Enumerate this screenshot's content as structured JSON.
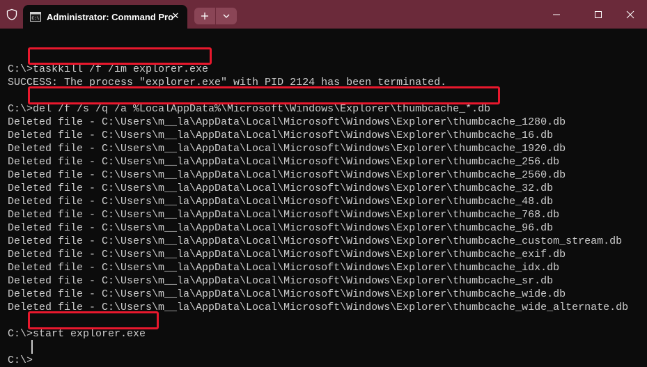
{
  "window": {
    "tab_title": "Administrator: Command Pro",
    "icons": [
      "shield-icon",
      "cmd-icon",
      "close-icon",
      "plus-icon",
      "chevron-down-icon",
      "minimize-icon",
      "maximize-icon",
      "window-close-icon"
    ]
  },
  "terminal": {
    "lines": [
      "",
      "C:\\>taskkill /f /im explorer.exe",
      "SUCCESS: The process \"explorer.exe\" with PID 2124 has been terminated.",
      "",
      "C:\\>del /f /s /q /a %LocalAppData%\\Microsoft\\Windows\\Explorer\\thumbcache_*.db",
      "Deleted file - C:\\Users\\m__la\\AppData\\Local\\Microsoft\\Windows\\Explorer\\thumbcache_1280.db",
      "Deleted file - C:\\Users\\m__la\\AppData\\Local\\Microsoft\\Windows\\Explorer\\thumbcache_16.db",
      "Deleted file - C:\\Users\\m__la\\AppData\\Local\\Microsoft\\Windows\\Explorer\\thumbcache_1920.db",
      "Deleted file - C:\\Users\\m__la\\AppData\\Local\\Microsoft\\Windows\\Explorer\\thumbcache_256.db",
      "Deleted file - C:\\Users\\m__la\\AppData\\Local\\Microsoft\\Windows\\Explorer\\thumbcache_2560.db",
      "Deleted file - C:\\Users\\m__la\\AppData\\Local\\Microsoft\\Windows\\Explorer\\thumbcache_32.db",
      "Deleted file - C:\\Users\\m__la\\AppData\\Local\\Microsoft\\Windows\\Explorer\\thumbcache_48.db",
      "Deleted file - C:\\Users\\m__la\\AppData\\Local\\Microsoft\\Windows\\Explorer\\thumbcache_768.db",
      "Deleted file - C:\\Users\\m__la\\AppData\\Local\\Microsoft\\Windows\\Explorer\\thumbcache_96.db",
      "Deleted file - C:\\Users\\m__la\\AppData\\Local\\Microsoft\\Windows\\Explorer\\thumbcache_custom_stream.db",
      "Deleted file - C:\\Users\\m__la\\AppData\\Local\\Microsoft\\Windows\\Explorer\\thumbcache_exif.db",
      "Deleted file - C:\\Users\\m__la\\AppData\\Local\\Microsoft\\Windows\\Explorer\\thumbcache_idx.db",
      "Deleted file - C:\\Users\\m__la\\AppData\\Local\\Microsoft\\Windows\\Explorer\\thumbcache_sr.db",
      "Deleted file - C:\\Users\\m__la\\AppData\\Local\\Microsoft\\Windows\\Explorer\\thumbcache_wide.db",
      "Deleted file - C:\\Users\\m__la\\AppData\\Local\\Microsoft\\Windows\\Explorer\\thumbcache_wide_alternate.db",
      "",
      "C:\\>start explorer.exe",
      "",
      "C:\\>"
    ]
  },
  "colors": {
    "titlebar": "#6b2a3a",
    "terminal_bg": "#0c0c0c",
    "terminal_fg": "#cccccc",
    "highlight": "#e8182d"
  }
}
